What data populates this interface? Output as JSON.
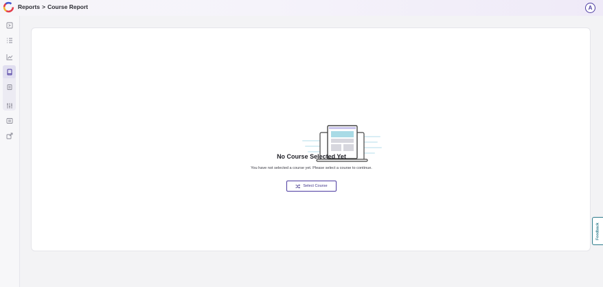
{
  "header": {
    "breadcrumb": [
      "Reports",
      ">",
      "Course Report"
    ],
    "avatar_initial": "A"
  },
  "sidebar": {
    "items": [
      {
        "icon": "form-icon"
      },
      {
        "icon": "list-icon"
      },
      {
        "icon": "chart-icon"
      },
      {
        "icon": "book-icon",
        "active": true
      },
      {
        "icon": "document-icon"
      },
      {
        "icon": "sliders-icon"
      },
      {
        "icon": "id-card-icon"
      },
      {
        "icon": "export-icon"
      }
    ]
  },
  "empty_state": {
    "title": "No Course Selected Yet",
    "description": "You have not selected a course yet. Please select a course to continue.",
    "button_label": "Select Course",
    "button_icon": "shuffle-icon"
  },
  "feedback_label": "Feedback",
  "colors": {
    "accent": "#4b3aa0",
    "feedback": "#2b7a8a",
    "background": "#f3f3f5",
    "card": "#ffffff"
  }
}
